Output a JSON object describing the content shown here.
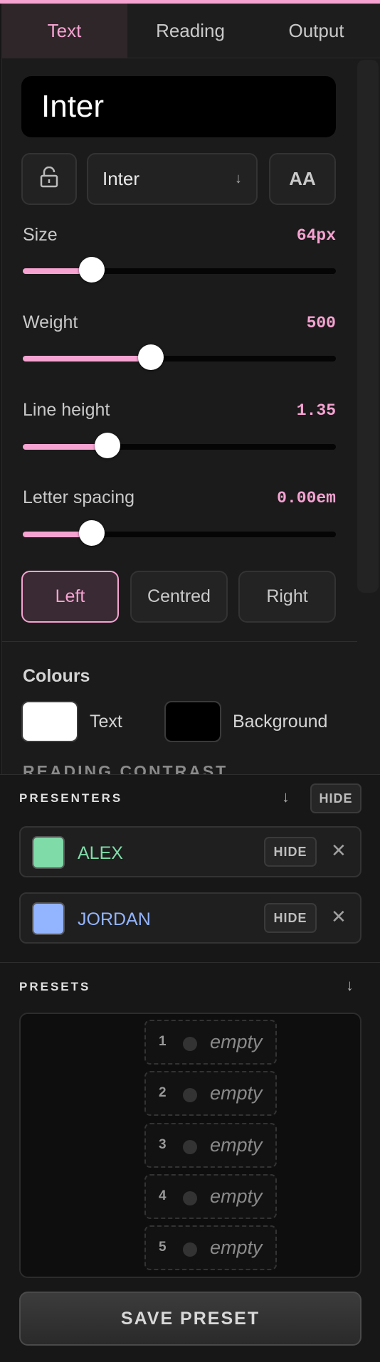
{
  "tabs": [
    {
      "label": "Text",
      "active": true
    },
    {
      "label": "Reading",
      "active": false
    },
    {
      "label": "Output",
      "active": false
    }
  ],
  "font": {
    "preview_text": "Inter",
    "selected_font": "Inter",
    "case_toggle_label": "AA",
    "lock_icon": "unlock-icon"
  },
  "sliders": [
    {
      "label": "Size",
      "value": "64px",
      "fraction": 0.22
    },
    {
      "label": "Weight",
      "value": "500",
      "fraction": 0.41
    },
    {
      "label": "Line height",
      "value": "1.35",
      "fraction": 0.27
    },
    {
      "label": "Letter spacing",
      "value": "0.00em",
      "fraction": 0.22
    }
  ],
  "alignment": {
    "options": [
      "Left",
      "Centred",
      "Right"
    ],
    "selected": "Left"
  },
  "colours": {
    "title": "Colours",
    "text_label": "Text",
    "text_color": "#ffffff",
    "background_label": "Background",
    "background_color": "#000000",
    "contrast_title": "READING CONTRAST"
  },
  "presenters": {
    "title": "PRESENTERS",
    "hide_label": "HIDE",
    "items": [
      {
        "name": "ALEX",
        "color": "#7fdca8",
        "hide_label": "HIDE"
      },
      {
        "name": "JORDAN",
        "color": "#93b4ff",
        "hide_label": "HIDE"
      }
    ]
  },
  "presets": {
    "title": "PRESETS",
    "slots": [
      {
        "number": "1",
        "label": "empty"
      },
      {
        "number": "2",
        "label": "empty"
      },
      {
        "number": "3",
        "label": "empty"
      },
      {
        "number": "4",
        "label": "empty"
      },
      {
        "number": "5",
        "label": "empty"
      }
    ],
    "save_label": "SAVE PRESET"
  },
  "theme": {
    "accent": "#f6a3d2",
    "background": "#161616"
  }
}
